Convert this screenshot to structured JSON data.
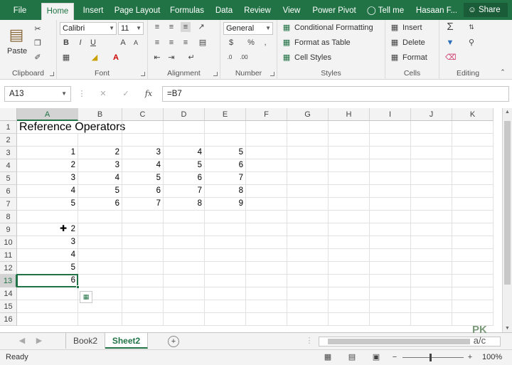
{
  "menu_tabs": [
    "File",
    "Home",
    "Insert",
    "Page Layout",
    "Formulas",
    "Data",
    "Review",
    "View",
    "Power Pivot"
  ],
  "tell_me": "Tell me",
  "user_name": "Hasaan F...",
  "share_label": "Share",
  "ribbon": {
    "clipboard": {
      "label": "Clipboard",
      "paste": "Paste"
    },
    "font": {
      "label": "Font",
      "name": "Calibri",
      "size": "11"
    },
    "alignment": {
      "label": "Alignment"
    },
    "number": {
      "label": "Number",
      "format": "General"
    },
    "styles": {
      "label": "Styles",
      "conditional": "Conditional Formatting",
      "format_table": "Format as Table",
      "cell_styles": "Cell Styles"
    },
    "cells": {
      "label": "Cells",
      "insert": "Insert",
      "delete": "Delete",
      "format": "Format"
    },
    "editing": {
      "label": "Editing"
    }
  },
  "name_box": "A13",
  "formula": "=B7",
  "columns": [
    "A",
    "B",
    "C",
    "D",
    "E",
    "F",
    "G",
    "H",
    "I",
    "J",
    "K"
  ],
  "rows": [
    "1",
    "2",
    "3",
    "4",
    "5",
    "6",
    "7",
    "8",
    "9",
    "10",
    "11",
    "12",
    "13",
    "14",
    "15",
    "16"
  ],
  "cells": {
    "A1": "Reference Operators",
    "A3": "1",
    "B3": "2",
    "C3": "3",
    "D3": "4",
    "E3": "5",
    "A4": "2",
    "B4": "3",
    "C4": "4",
    "D4": "5",
    "E4": "6",
    "A5": "3",
    "B5": "4",
    "C5": "5",
    "D5": "6",
    "E5": "7",
    "A6": "4",
    "B6": "5",
    "C6": "6",
    "D6": "7",
    "E6": "8",
    "A7": "5",
    "B7": "6",
    "C7": "7",
    "D7": "8",
    "E7": "9",
    "A9": "2",
    "A10": "3",
    "A11": "4",
    "A12": "5",
    "A13": "6"
  },
  "sheets": [
    "Book2",
    "Sheet2"
  ],
  "active_sheet": "Sheet2",
  "status": "Ready",
  "zoom": "100%",
  "watermark": {
    "line1": "PK",
    "line2": "a/c"
  },
  "colors": {
    "accent": "#217346"
  }
}
